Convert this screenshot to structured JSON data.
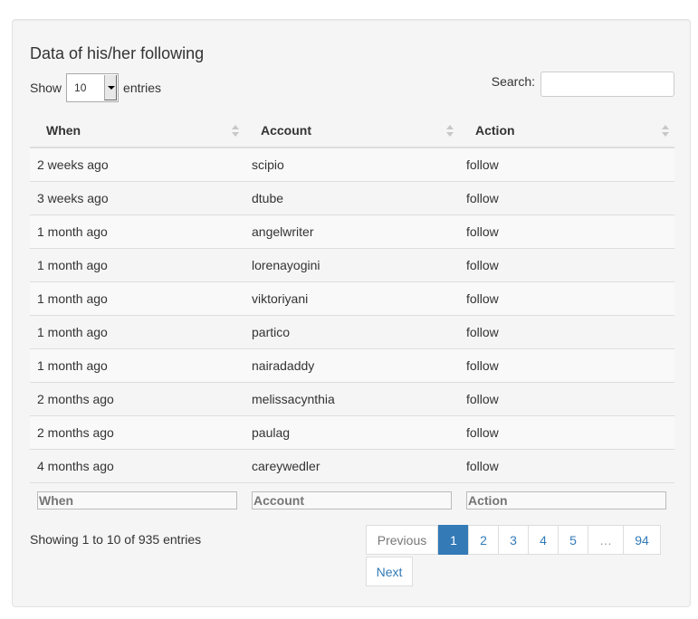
{
  "title": "Data of his/her following",
  "length": {
    "show_label": "Show",
    "value": "10",
    "entries_label": "entries"
  },
  "search": {
    "label": "Search:",
    "value": ""
  },
  "columns": [
    "When",
    "Account",
    "Action"
  ],
  "rows": [
    [
      "2 weeks ago",
      "scipio",
      "follow"
    ],
    [
      "3 weeks ago",
      "dtube",
      "follow"
    ],
    [
      "1 month ago",
      "angelwriter",
      "follow"
    ],
    [
      "1 month ago",
      "lorenayogini",
      "follow"
    ],
    [
      "1 month ago",
      "viktoriyani",
      "follow"
    ],
    [
      "1 month ago",
      "partico",
      "follow"
    ],
    [
      "1 month ago",
      "nairadaddy",
      "follow"
    ],
    [
      "2 months ago",
      "melissacynthia",
      "follow"
    ],
    [
      "2 months ago",
      "paulag",
      "follow"
    ],
    [
      "4 months ago",
      "careywedler",
      "follow"
    ]
  ],
  "filters": {
    "placeholders": [
      "When",
      "Account",
      "Action"
    ]
  },
  "info": "Showing 1 to 10 of 935 entries",
  "pagination": {
    "previous": "Previous",
    "pages": [
      "1",
      "2",
      "3",
      "4",
      "5",
      "…",
      "94"
    ],
    "active_page": "1",
    "next": "Next"
  },
  "colors": {
    "accent": "#337ab7",
    "panel_bg": "#f5f5f5"
  }
}
